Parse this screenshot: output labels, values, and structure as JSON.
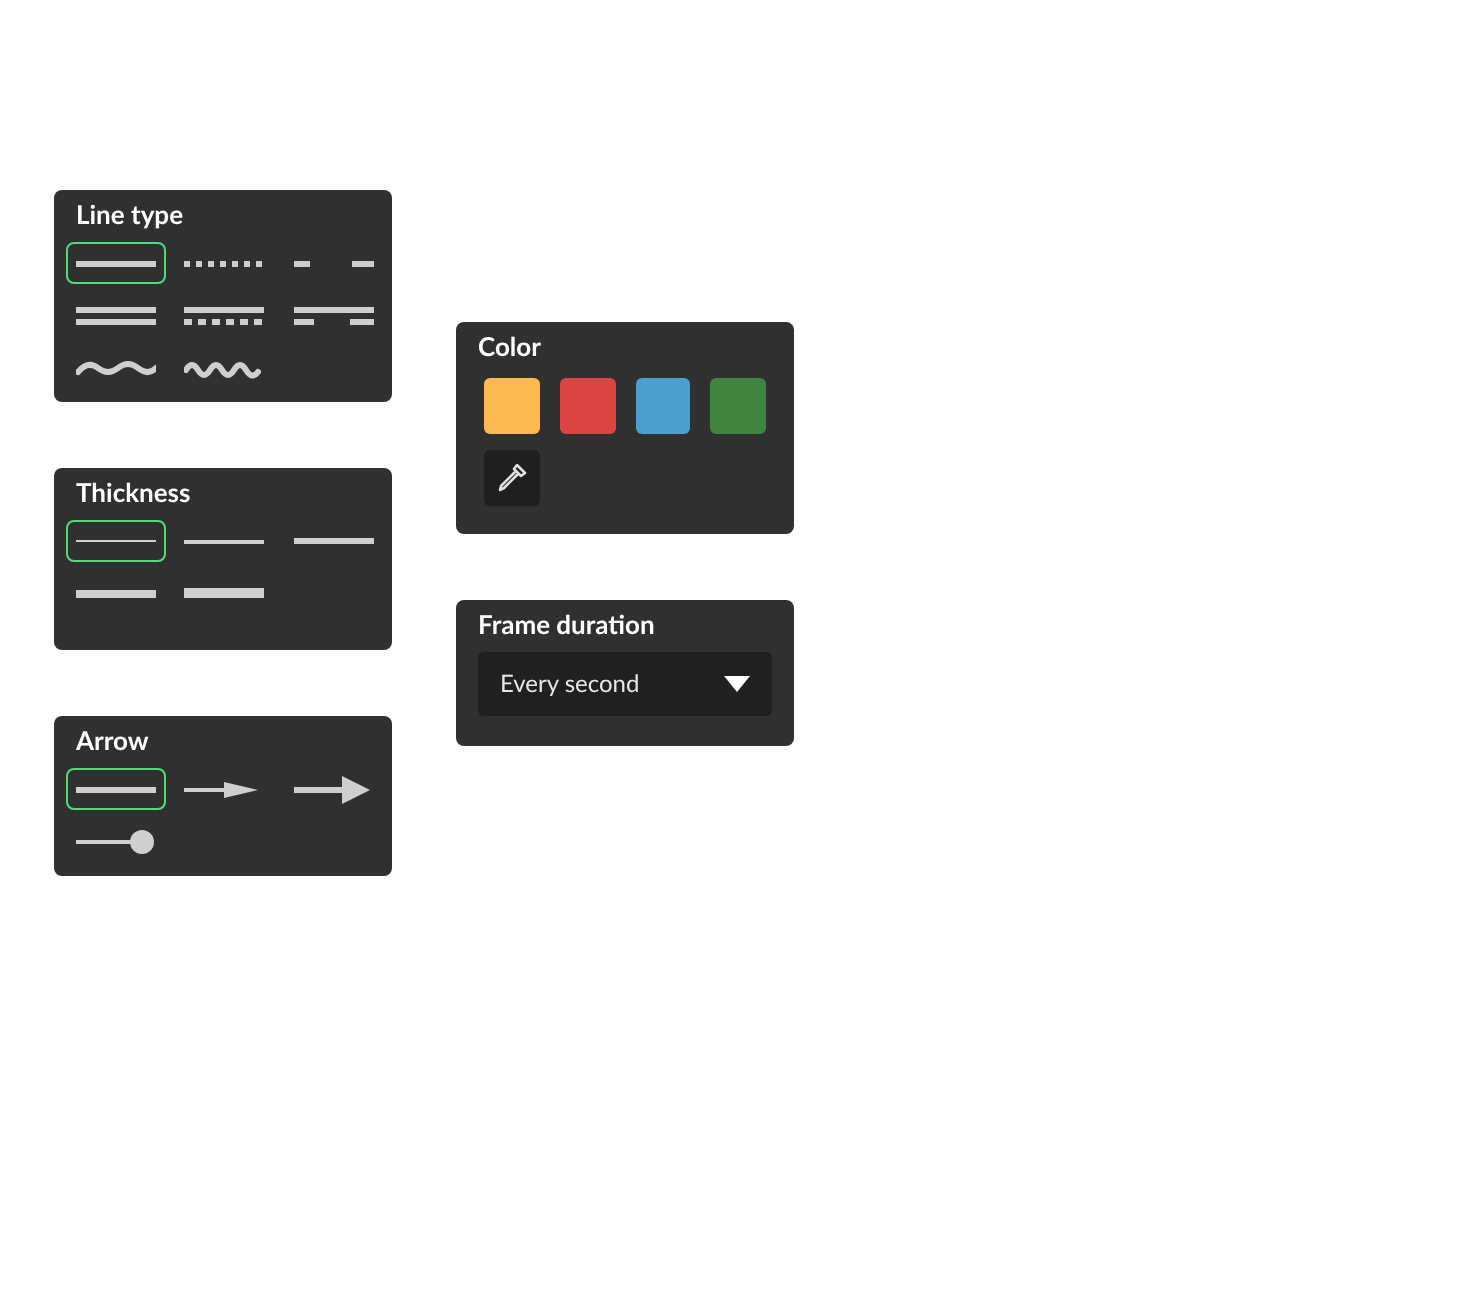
{
  "line_type": {
    "title": "Line type",
    "options": [
      {
        "kind": "solid",
        "selected": true
      },
      {
        "kind": "dotted",
        "selected": false
      },
      {
        "kind": "dashed",
        "selected": false
      },
      {
        "kind": "double",
        "selected": false
      },
      {
        "kind": "doubledotted",
        "selected": false
      },
      {
        "kind": "doubledashed",
        "selected": false
      },
      {
        "kind": "wave",
        "selected": false
      },
      {
        "kind": "squiggle",
        "selected": false
      }
    ]
  },
  "thickness": {
    "title": "Thickness",
    "options": [
      {
        "kind": "hairline",
        "selected": true
      },
      {
        "kind": "thin",
        "selected": false
      },
      {
        "kind": "medium",
        "selected": false
      },
      {
        "kind": "thick",
        "selected": false
      },
      {
        "kind": "heavy",
        "selected": false
      }
    ]
  },
  "arrow": {
    "title": "Arrow",
    "options": [
      {
        "kind": "none",
        "selected": true
      },
      {
        "kind": "small",
        "selected": false
      },
      {
        "kind": "large",
        "selected": false
      },
      {
        "kind": "dot",
        "selected": false
      }
    ]
  },
  "color": {
    "title": "Color",
    "swatches": [
      {
        "color": "#fcb94f"
      },
      {
        "color": "#dc4343"
      },
      {
        "color": "#4c9fcf"
      },
      {
        "color": "#41843f"
      }
    ]
  },
  "frame_duration": {
    "title": "Frame duration",
    "value": "Every second"
  }
}
